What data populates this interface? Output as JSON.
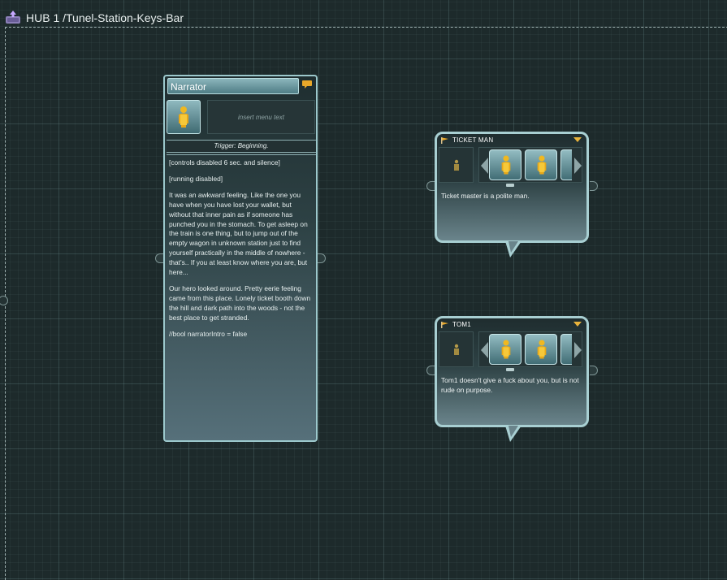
{
  "breadcrumb": {
    "title": "HUB 1 /Tunel-Station-Keys-Bar",
    "icon": "hub-icon"
  },
  "narrator_node": {
    "speaker": "Narrator",
    "menu_text_placeholder": "insert menu text",
    "trigger": "Trigger: Beginning.",
    "paragraphs": [
      "[controls disabled 6 sec. and silence]",
      "[running disabled]",
      "It was an awkward feeling. Like the one you have when you have lost your wallet, but without that inner pain as if someone has punched you in the stomach. To get asleep on the train is one thing, but to jump out of the empty wagon in unknown station just to find yourself practically in the middle of nowhere - that's.. If you at least know where you are, but here...",
      "Our hero looked around. Pretty eerie feeling came from this place. Lonely ticket booth down the hill and dark path into the woods - not the best place to get stranded.",
      "//bool narratorIntro = false"
    ],
    "icons": [
      "comment-icon",
      "person-icon"
    ]
  },
  "dialogue_nodes": [
    {
      "speaker": "TICKET MAN",
      "text": "Ticket master is a polite man."
    },
    {
      "speaker": "TOM1",
      "text": "Tom1 doesn't give a fuck about you, but is not rude on purpose."
    }
  ],
  "colors": {
    "background": "#1d2a2b",
    "node_border": "#a8cfd2",
    "accent_orange": "#e8b33c",
    "person_gold": "#e8b020"
  }
}
